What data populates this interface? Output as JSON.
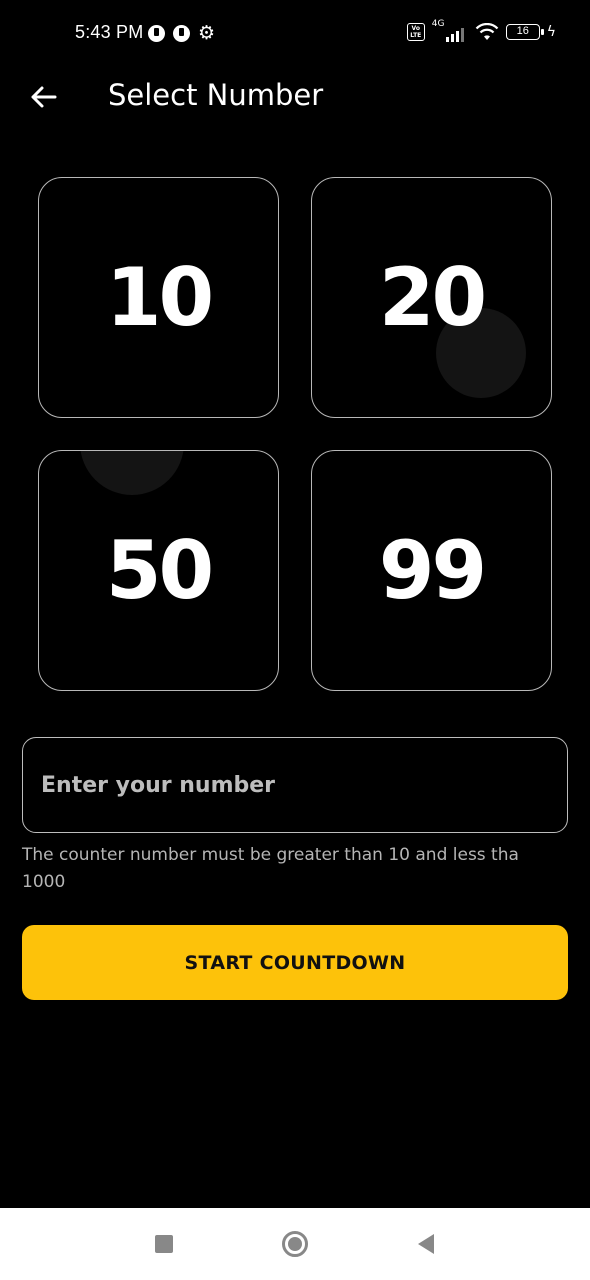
{
  "status_bar": {
    "time": "5:43 PM",
    "network": "4G",
    "volte": "Vo LTE",
    "battery": "16"
  },
  "header": {
    "title": "Select Number",
    "back_icon": "arrow-left-icon"
  },
  "options": [
    {
      "value": "10"
    },
    {
      "value": "20"
    },
    {
      "value": "50"
    },
    {
      "value": "99"
    }
  ],
  "input": {
    "placeholder": "Enter your number",
    "value": ""
  },
  "helper_text": "The counter number must be greater than 10 and less tha 1000",
  "start_button": {
    "label": "START COUNTDOWN"
  },
  "colors": {
    "background": "#000000",
    "accent": "#FDC20A",
    "border": "#b8b8b8"
  }
}
